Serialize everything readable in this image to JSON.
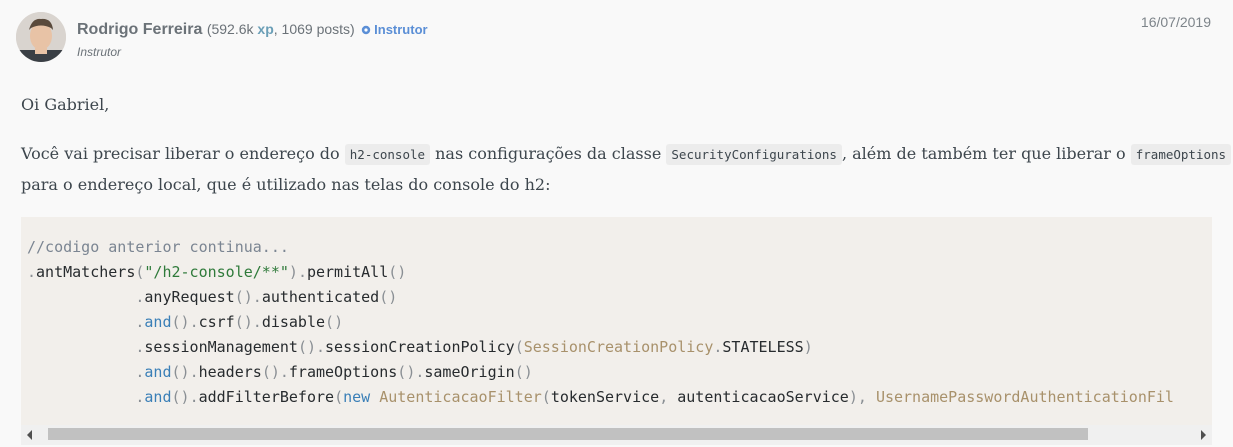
{
  "post": {
    "author": {
      "name": "Rodrigo Ferreira",
      "stats_prefix": "(592.6k ",
      "xp_label": "xp",
      "stats_suffix": ", 1069 posts)",
      "badge": "Instrutor",
      "role": "Instrutor"
    },
    "date": "16/07/2019",
    "greeting": "Oi Gabriel,",
    "body": {
      "part1": "Você vai precisar liberar o endereço do ",
      "code1": "h2-console",
      "part2": " nas configurações da classe ",
      "code2": "SecurityConfigurations",
      "part3": ", além de também ter que liberar o ",
      "code3": "frameOptions",
      "line2": "para o endereço local, que é utilizado nas telas do console do h2:"
    }
  },
  "code_lines": [
    "//codigo anterior continua...",
    ".antMatchers(\"/h2-console/**\").permitAll()",
    "            .anyRequest().authenticated()",
    "            .and().csrf().disable()",
    "            .sessionManagement().sessionCreationPolicy(SessionCreationPolicy.STATELESS)",
    "            .and().headers().frameOptions().sameOrigin()",
    "            .and().addFilterBefore(new AutenticacaoFilter(tokenService, autenticacaoService), UsernamePasswordAuthenticationFil"
  ],
  "colors": {
    "xp": "#6b9fb7",
    "badge": "#5b8fd6",
    "code_background": "#f2efeb"
  },
  "icons": {
    "badge": "gear-badge-icon",
    "scroll_left": "scroll-left-arrow-icon",
    "scroll_right": "scroll-right-arrow-icon"
  }
}
